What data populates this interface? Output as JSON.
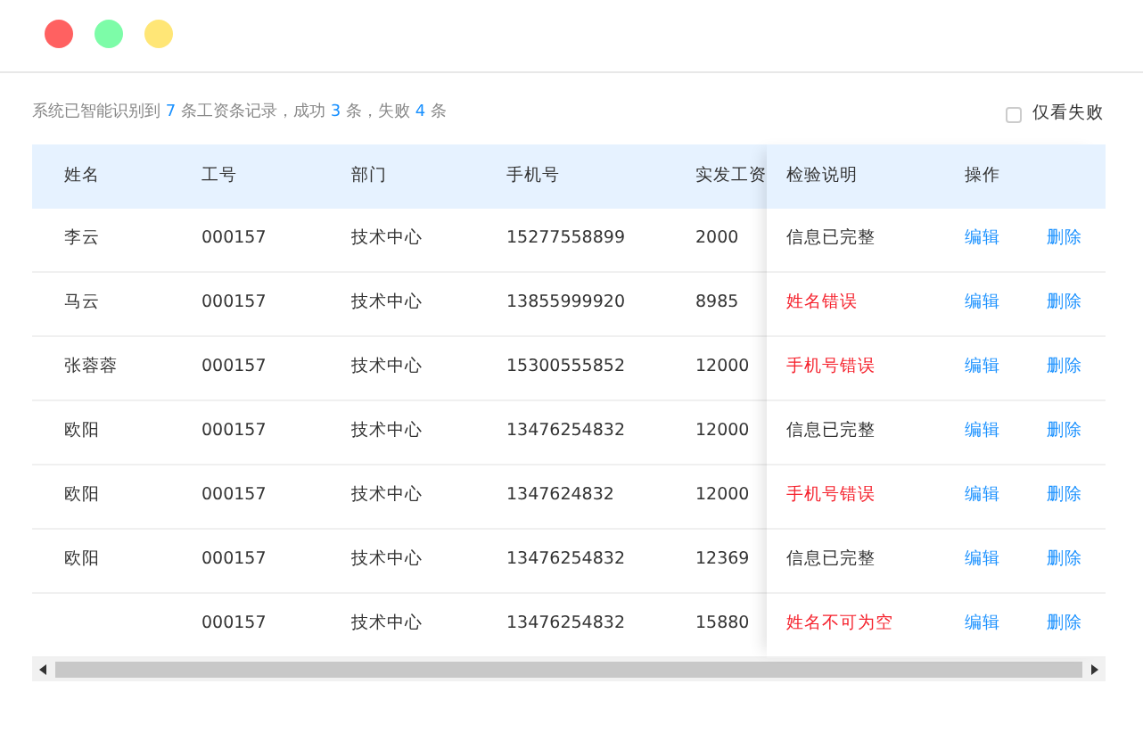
{
  "window": {
    "controls": [
      {
        "color": "#ff6161"
      },
      {
        "color": "#7dfca8"
      },
      {
        "color": "#ffe676"
      }
    ]
  },
  "summary": [
    {
      "text": "系统已智能识别到 ",
      "highlight": false
    },
    {
      "text": "7",
      "highlight": true
    },
    {
      "text": " 条工资条记录，成功 ",
      "highlight": false
    },
    {
      "text": "3",
      "highlight": true
    },
    {
      "text": " 条，失败 ",
      "highlight": false
    },
    {
      "text": "4",
      "highlight": true
    },
    {
      "text": " 条",
      "highlight": false
    }
  ],
  "filter": {
    "label": "仅看失败",
    "checked": false
  },
  "table": {
    "columns": [
      "姓名",
      "工号",
      "部门",
      "手机号",
      "实发工资",
      "检验说明",
      "操作"
    ],
    "rows": [
      {
        "name": "李云",
        "id": "000157",
        "department": "技术中心",
        "phone": "15277558899",
        "salary": "2000",
        "check": "信息已完整",
        "error": false,
        "actions": [
          "编辑",
          "删除"
        ]
      },
      {
        "name": "马云",
        "id": "000157",
        "department": "技术中心",
        "phone": "13855999920",
        "salary": "8985",
        "check": "姓名错误",
        "error": true,
        "actions": [
          "编辑",
          "删除"
        ]
      },
      {
        "name": "张蓉蓉",
        "id": "000157",
        "department": "技术中心",
        "phone": "15300555852",
        "salary": "12000",
        "check": "手机号错误",
        "error": true,
        "actions": [
          "编辑",
          "删除"
        ]
      },
      {
        "name": "欧阳",
        "id": "000157",
        "department": "技术中心",
        "phone": "13476254832",
        "salary": "12000",
        "check": "信息已完整",
        "error": false,
        "actions": [
          "编辑",
          "删除"
        ]
      },
      {
        "name": "欧阳",
        "id": "000157",
        "department": "技术中心",
        "phone": "1347624832",
        "salary": "12000",
        "check": "手机号错误",
        "error": true,
        "actions": [
          "编辑",
          "删除"
        ]
      },
      {
        "name": "欧阳",
        "id": "000157",
        "department": "技术中心",
        "phone": "13476254832",
        "salary": "12369",
        "check": "信息已完整",
        "error": false,
        "actions": [
          "编辑",
          "删除"
        ]
      },
      {
        "id": "000157",
        "department": "技术中心",
        "phone": "13476254832",
        "salary": "15880",
        "check": "姓名不可为空",
        "error": true,
        "actions": [
          "编辑",
          "删除"
        ]
      }
    ]
  }
}
